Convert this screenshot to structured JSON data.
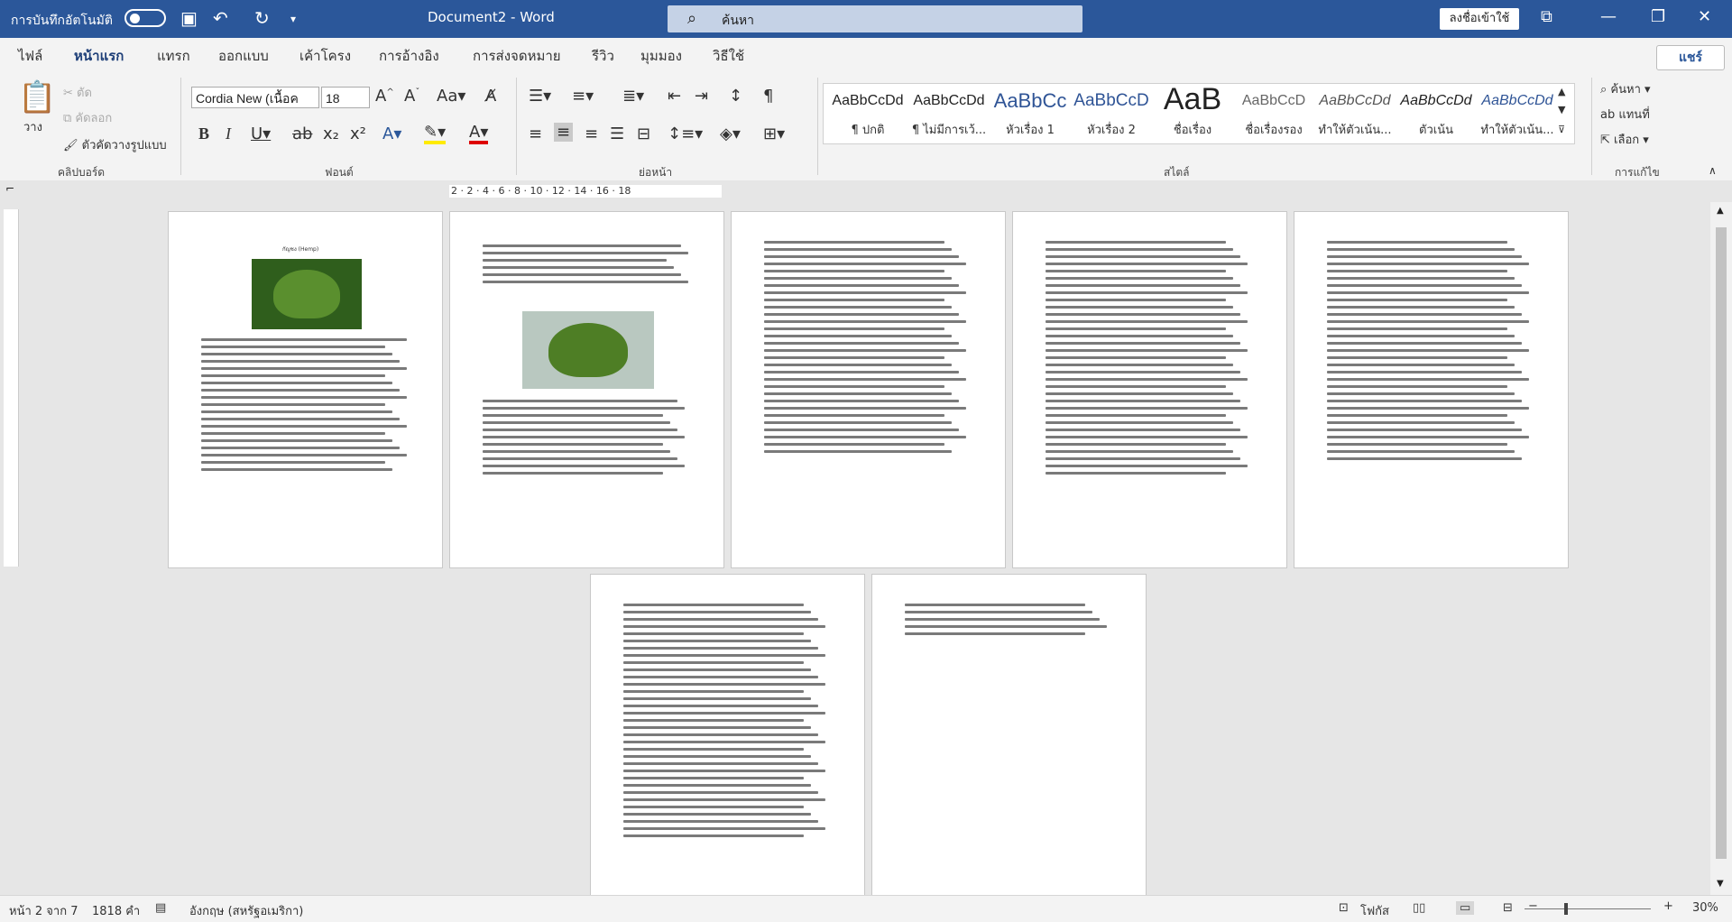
{
  "titlebar": {
    "autosave_label": "การบันทึกอัตโนมัติ",
    "autosave_state": "off",
    "doc_title": "Document2  -  Word",
    "search_placeholder": "ค้นหา",
    "signin_label": "ลงชื่อเข้าใช้"
  },
  "tabs": [
    "ไฟล์",
    "หน้าแรก",
    "แทรก",
    "ออกแบบ",
    "เค้าโครง",
    "การอ้างอิง",
    "การส่งจดหมาย",
    "รีวิว",
    "มุมมอง",
    "วิธีใช้"
  ],
  "active_tab": "หน้าแรก",
  "share_label": "แชร์",
  "ribbon": {
    "clipboard": {
      "paste": "วาง",
      "cut": "ตัด",
      "copy": "คัดลอก",
      "format_painter": "ตัวคัดวางรูปแบบ",
      "label": "คลิปบอร์ด"
    },
    "font": {
      "name": "Cordia New (เนื้อค",
      "size": "18",
      "label": "ฟอนต์"
    },
    "paragraph": {
      "label": "ย่อหน้า"
    },
    "styles": {
      "label": "สไตล์",
      "items": [
        {
          "preview": "AaBbCcDd",
          "name": "¶ ปกติ"
        },
        {
          "preview": "AaBbCcDd",
          "name": "¶ ไม่มีการเว้..."
        },
        {
          "preview": "AaBbCc",
          "name": "หัวเรื่อง 1"
        },
        {
          "preview": "AaBbCcD",
          "name": "หัวเรื่อง 2"
        },
        {
          "preview": "AaB",
          "name": "ชื่อเรื่อง"
        },
        {
          "preview": "AaBbCcD",
          "name": "ชื่อเรื่องรอง"
        },
        {
          "preview": "AaBbCcDd",
          "name": "ทำให้ตัวเน้น..."
        },
        {
          "preview": "AaBbCcDd",
          "name": "ตัวเน้น"
        },
        {
          "preview": "AaBbCcDd",
          "name": "ทำให้ตัวเน้น..."
        }
      ]
    },
    "editing": {
      "find": "ค้นหา",
      "replace": "แทนที่",
      "select": "เลือก",
      "label": "การแก้ไข"
    }
  },
  "ruler_numbers": "2  ·  2  ·  4  ·  6  ·  8  ·  10  ·  12  ·  14  ·  16  ·  18",
  "page1_title": "กัญชง (Hemp)",
  "status": {
    "page": "หน้า 2 จาก 7",
    "words": "1818 คำ",
    "language": "อังกฤษ (สหรัฐอเมริกา)",
    "focus": "โฟกัส",
    "zoom": "30%"
  },
  "colors": {
    "titlebar": "#2b579a",
    "accent": "#2b579a"
  }
}
